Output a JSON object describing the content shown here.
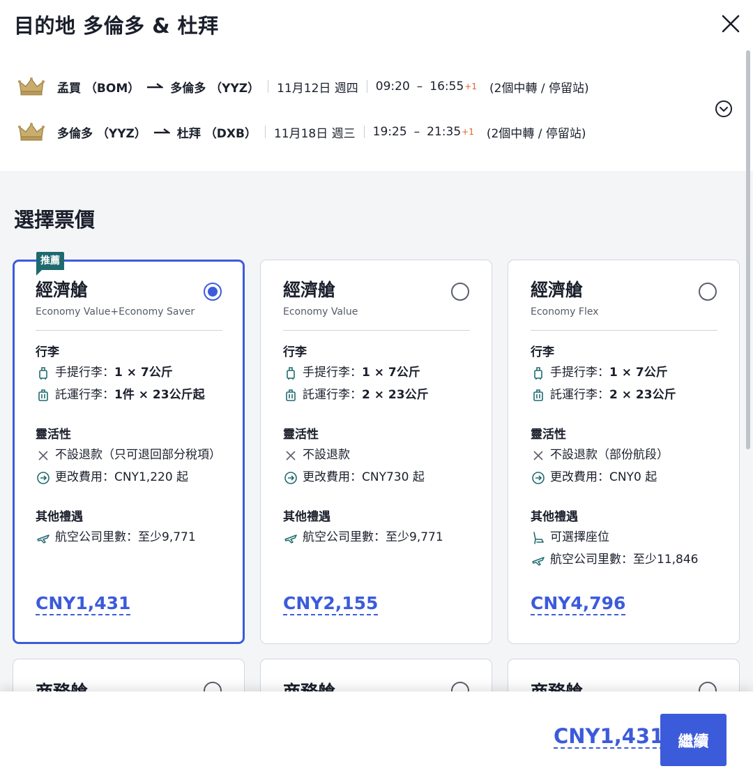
{
  "header": {
    "title": "目的地 多倫多 & 杜拜",
    "close_icon": "close-icon",
    "expand_icon": "chevron-down-circle-icon"
  },
  "itinerary": [
    {
      "route": "孟買 （BOM）",
      "route_to": "多倫多 （YYZ）",
      "date": "11月12日 週四",
      "depart": "09:20",
      "arrive": "16:55",
      "day_offset": "+1",
      "stops": "(2個中轉 / 停留站)"
    },
    {
      "route": "多倫多 （YYZ）",
      "route_to": "杜拜 （DXB）",
      "date": "11月18日 週三",
      "depart": "19:25",
      "arrive": "21:35",
      "day_offset": "+1",
      "stops": "(2個中轉 / 停留站)"
    }
  ],
  "section_title": "選擇票價",
  "fares": [
    {
      "badge": "推薦",
      "cabin": "經濟艙",
      "fare_name": "Economy Value+Economy Saver",
      "selected": true,
      "baggage_title": "行李",
      "carry_on_label": "手提行李：",
      "carry_on_value": "1 × 7公斤",
      "checked_label": "託運行李：",
      "checked_value": "1件 × 23公斤起",
      "flex_title": "靈活性",
      "refund": "不設退款（只可退回部分稅項）",
      "change_fee": "更改費用：CNY1,220 起",
      "perks_title": "其他禮遇",
      "seat": "",
      "miles": "航空公司里數：至少9,771",
      "price": "CNY1,431"
    },
    {
      "badge": "",
      "cabin": "經濟艙",
      "fare_name": "Economy Value",
      "selected": false,
      "baggage_title": "行李",
      "carry_on_label": "手提行李：",
      "carry_on_value": "1 × 7公斤",
      "checked_label": "託運行李：",
      "checked_value": "2 × 23公斤",
      "flex_title": "靈活性",
      "refund": "不設退款",
      "change_fee": "更改費用：CNY730 起",
      "perks_title": "其他禮遇",
      "seat": "",
      "miles": "航空公司里數：至少9,771",
      "price": "CNY2,155"
    },
    {
      "badge": "",
      "cabin": "經濟艙",
      "fare_name": "Economy Flex",
      "selected": false,
      "baggage_title": "行李",
      "carry_on_label": "手提行李：",
      "carry_on_value": "1 × 7公斤",
      "checked_label": "託運行李：",
      "checked_value": "2 × 23公斤",
      "flex_title": "靈活性",
      "refund": "不設退款（部份航段）",
      "change_fee": "更改費用：CNY0 起",
      "perks_title": "其他禮遇",
      "seat": "可選擇座位",
      "miles": "航空公司里數：至少11,846",
      "price": "CNY4,796"
    }
  ],
  "fares_row2": [
    {
      "cabin": "商務艙"
    },
    {
      "cabin": "商務艙"
    },
    {
      "cabin": "商務艙"
    }
  ],
  "footer": {
    "total_price": "CNY1,431",
    "continue_label": "繼續"
  },
  "colors": {
    "accent": "#3c5bdb",
    "badge": "#1f6a6f",
    "day_offset": "#e0602b",
    "crown": "#b89a5a"
  }
}
